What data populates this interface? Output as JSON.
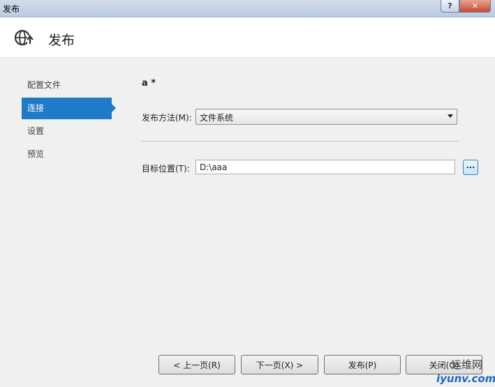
{
  "window": {
    "title": "发布",
    "help_symbol": "?",
    "close_symbol": "✕"
  },
  "header": {
    "title": "发布",
    "icon": "globe-publish-icon"
  },
  "nav": {
    "items": [
      {
        "label": "配置文件",
        "active": false
      },
      {
        "label": "连接",
        "active": true
      },
      {
        "label": "设置",
        "active": false
      },
      {
        "label": "预览",
        "active": false
      }
    ]
  },
  "main": {
    "profile_name": "a *",
    "publish_method_label": "发布方法(M):",
    "publish_method_value": "文件系统",
    "target_location_label": "目标位置(T):",
    "target_location_value": "D:\\aaa",
    "browse_label": "..."
  },
  "footer": {
    "prev_label": "< 上一页(R)",
    "next_label": "下一页(X) >",
    "publish_label": "发布(P)",
    "close_label": "关闭(O)"
  },
  "watermark": {
    "line1": "运维网",
    "line2": "iyunv.com"
  },
  "colors": {
    "accent": "#1f7ac7"
  }
}
